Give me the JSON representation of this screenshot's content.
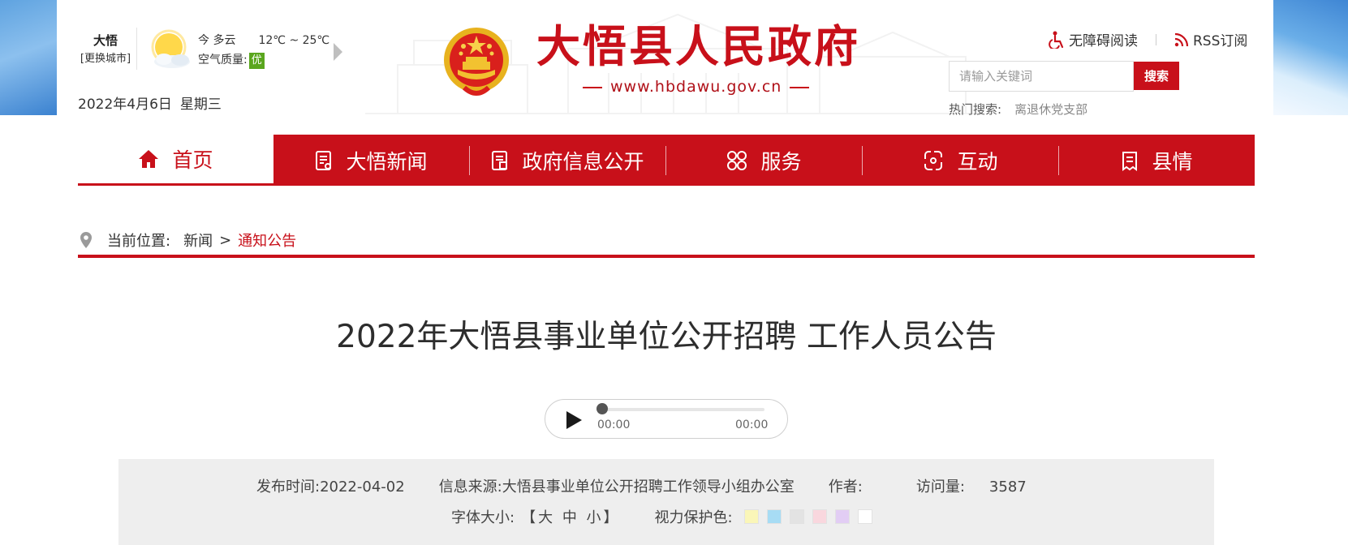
{
  "header": {
    "city": {
      "name": "大悟",
      "switch_label": "[更换城市]"
    },
    "weather": {
      "condition": "今 多云",
      "temp": "12℃ ~ 25℃",
      "aq_label": "空气质量:",
      "aq_value": "优",
      "aq_color": "#5aa61e"
    },
    "date": "2022年4月6日",
    "weekday": "星期三",
    "site_title": "大悟县人民政府",
    "site_url": "www.hbdawu.gov.cn",
    "accessibility_label": "无障碍阅读",
    "rss_label": "RSS订阅",
    "search": {
      "placeholder": "请输入关键词",
      "button_label": "搜索"
    },
    "hot_search": {
      "label": "热门搜索:",
      "items": [
        "离退休党支部"
      ]
    }
  },
  "nav": {
    "items": [
      {
        "label": "首页",
        "icon": "home-icon"
      },
      {
        "label": "大悟新闻",
        "icon": "news-document-icon"
      },
      {
        "label": "政府信息公开",
        "icon": "info-document-icon"
      },
      {
        "label": "服务",
        "icon": "service-grid-icon"
      },
      {
        "label": "互动",
        "icon": "interaction-icon"
      },
      {
        "label": "县情",
        "icon": "county-info-icon"
      }
    ],
    "active_index": 0
  },
  "breadcrumb": {
    "label": "当前位置:",
    "items": [
      "新闻",
      "通知公告"
    ],
    "separator": ">"
  },
  "article": {
    "title": "2022年大悟县事业单位公开招聘 工作人员公告",
    "audio": {
      "current_time": "00:00",
      "duration": "00:00",
      "progress": 0
    },
    "meta": {
      "publish_label": "发布时间:",
      "publish_date": "2022-04-02",
      "source_label": "信息来源:",
      "source": "大悟县事业单位公开招聘工作领导小组办公室",
      "author_label": "作者:",
      "author": "",
      "views_label": "访问量:",
      "views": "3587",
      "font_size_label": "字体大小:",
      "font_size_open": "【",
      "font_large": "大",
      "font_medium": "中",
      "font_small": "小",
      "font_size_close": "】",
      "eye_care_label": "视力保护色:",
      "eye_care_colors": [
        "#faf6b8",
        "#a7dcf4",
        "#e3e3e3",
        "#f9d7de",
        "#e2cdf4",
        "#ffffff"
      ]
    }
  },
  "colors": {
    "brand_red": "#c8101a",
    "meta_bg": "#eeeeee"
  }
}
